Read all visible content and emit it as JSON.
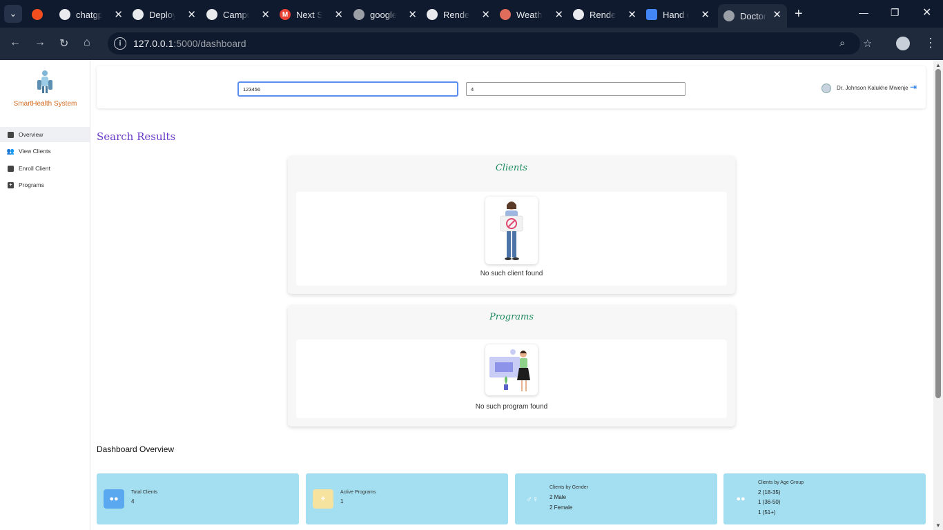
{
  "browser": {
    "tabs": [
      {
        "title": "",
        "favicon": "figma-icon",
        "color": "#f24e1e"
      },
      {
        "title": "chatgpt",
        "favicon": "openai-icon",
        "color": "#e8eaed"
      },
      {
        "title": "Deploy",
        "favicon": "openai-icon",
        "color": "#e8eaed"
      },
      {
        "title": "Campus",
        "favicon": "github-icon",
        "color": "#e8eaed"
      },
      {
        "title": "Next S",
        "favicon": "gmail-icon",
        "color": "#ea4335"
      },
      {
        "title": "google",
        "favicon": "globe-icon",
        "color": "#9aa0a6"
      },
      {
        "title": "Render",
        "favicon": "render-icon",
        "color": "#e8eaed"
      },
      {
        "title": "Weath",
        "favicon": "weather-icon",
        "color": "#e06c5b"
      },
      {
        "title": "Render",
        "favicon": "render-icon",
        "color": "#e8eaed"
      },
      {
        "title": "Hand o",
        "favicon": "forms-icon",
        "color": "#4285f4"
      },
      {
        "title": "Doctor",
        "favicon": "globe-icon",
        "color": "#9aa0a6"
      }
    ],
    "url_host": "127.0.0.1",
    "url_path": ":5000/dashboard"
  },
  "sidebar": {
    "brand": "SmartHealth System",
    "items": [
      {
        "label": "Overview",
        "icon": "dashboard-icon"
      },
      {
        "label": "View Clients",
        "icon": "users-icon"
      },
      {
        "label": "Enroll Client",
        "icon": "clipboard-icon"
      },
      {
        "label": "Programs",
        "icon": "plus-square-icon"
      }
    ]
  },
  "topbar": {
    "search_value": "123456",
    "search2_value": "4",
    "doctor_name": "Dr. Johnson Kalukhe Mwenje"
  },
  "results": {
    "title": "Search Results",
    "clients": {
      "title": "Clients",
      "empty": "No such client found"
    },
    "programs": {
      "title": "Programs",
      "empty": "No such program found"
    }
  },
  "dashboard": {
    "title": "Dashboard Overview",
    "total_clients": {
      "label": "Total Clients",
      "value": "4",
      "icon_color": "#5aa9f0"
    },
    "active_programs": {
      "label": "Active Programs",
      "value": "1",
      "icon_color": "#f7e3a0"
    },
    "gender": {
      "label": "Clients by Gender",
      "male": "2 Male",
      "female": "2 Female"
    },
    "age": {
      "label": "Clients by Age Group",
      "g1": "2 (18-35)",
      "g2": "1 (36-50)",
      "g3": "1 (51+)"
    }
  }
}
